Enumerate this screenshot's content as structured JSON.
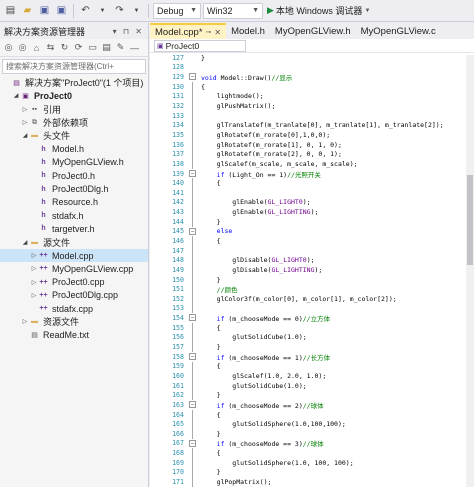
{
  "toolbar": {
    "config": "Debug",
    "platform": "Win32",
    "run_label": "本地 Windows 调试器"
  },
  "solution_explorer": {
    "title": "解决方案资源管理器",
    "search_placeholder": "搜索解决方案资源管理器(Ctrl+",
    "items": [
      {
        "label": "解决方案\"ProJect0\"(1 个项目)",
        "icon": "solution-icon",
        "indent": 0,
        "expander": ""
      },
      {
        "label": "ProJect0",
        "icon": "project-icon",
        "indent": 1,
        "expander": "▲",
        "bold": true
      },
      {
        "label": "引用",
        "icon": "references-icon",
        "indent": 2,
        "expander": "▶"
      },
      {
        "label": "外部依赖项",
        "icon": "external-deps-icon",
        "indent": 2,
        "expander": "▶"
      },
      {
        "label": "头文件",
        "icon": "folder-icon",
        "indent": 2,
        "expander": "▲"
      },
      {
        "label": "Model.h",
        "icon": "header-file-icon",
        "indent": 3,
        "expander": ""
      },
      {
        "label": "MyOpenGLView.h",
        "icon": "header-file-icon",
        "indent": 3,
        "expander": ""
      },
      {
        "label": "ProJect0.h",
        "icon": "header-file-icon",
        "indent": 3,
        "expander": ""
      },
      {
        "label": "ProJect0Dlg.h",
        "icon": "header-file-icon",
        "indent": 3,
        "expander": ""
      },
      {
        "label": "Resource.h",
        "icon": "header-file-icon",
        "indent": 3,
        "expander": ""
      },
      {
        "label": "stdafx.h",
        "icon": "header-file-icon",
        "indent": 3,
        "expander": ""
      },
      {
        "label": "targetver.h",
        "icon": "header-file-icon",
        "indent": 3,
        "expander": ""
      },
      {
        "label": "源文件",
        "icon": "folder-icon",
        "indent": 2,
        "expander": "▲"
      },
      {
        "label": "Model.cpp",
        "icon": "cpp-file-icon",
        "indent": 3,
        "expander": "▶",
        "selected": true
      },
      {
        "label": "MyOpenGLView.cpp",
        "icon": "cpp-file-icon",
        "indent": 3,
        "expander": "▶"
      },
      {
        "label": "ProJect0.cpp",
        "icon": "cpp-file-icon",
        "indent": 3,
        "expander": "▶"
      },
      {
        "label": "ProJect0Dlg.cpp",
        "icon": "cpp-file-icon",
        "indent": 3,
        "expander": "▶"
      },
      {
        "label": "stdafx.cpp",
        "icon": "cpp-file-icon",
        "indent": 3,
        "expander": ""
      },
      {
        "label": "资源文件",
        "icon": "folder-icon",
        "indent": 2,
        "expander": "▶"
      },
      {
        "label": "ReadMe.txt",
        "icon": "text-file-icon",
        "indent": 2,
        "expander": ""
      }
    ]
  },
  "editor": {
    "tabs": [
      {
        "label": "Model.cpp*",
        "active": true
      },
      {
        "label": "Model.h",
        "active": false
      },
      {
        "label": "MyOpenGLView.h",
        "active": false
      },
      {
        "label": "MyOpenGLView.c",
        "active": false
      }
    ],
    "nav_scope": "ProJect0",
    "lines": [
      {
        "n": "127",
        "code": "}"
      },
      {
        "n": "128",
        "code": ""
      },
      {
        "n": "129",
        "code": "void Model::Draw()//显示",
        "fold": true
      },
      {
        "n": "130",
        "code": "{"
      },
      {
        "n": "131",
        "code": "    lightmode();"
      },
      {
        "n": "132",
        "code": "    glPushMatrix();"
      },
      {
        "n": "133",
        "code": ""
      },
      {
        "n": "134",
        "code": "    glTranslatef(m_tranlate[0], m_tranlate[1], m_tranlate[2]);"
      },
      {
        "n": "135",
        "code": "    glRotatef(m_rorate[0],1,0,0);"
      },
      {
        "n": "136",
        "code": "    glRotatef(m_rorate[1], 0, 1, 0);"
      },
      {
        "n": "137",
        "code": "    glRotatef(m_rorate[2], 0, 0, 1);"
      },
      {
        "n": "138",
        "code": "    glScalef(m_scale, m_scale, m_scale);"
      },
      {
        "n": "139",
        "code": "    if (Light_On == 1)//光照开关",
        "fold": true
      },
      {
        "n": "140",
        "code": "    {"
      },
      {
        "n": "141",
        "code": ""
      },
      {
        "n": "142",
        "code": "        glEnable(GL_LIGHT0);"
      },
      {
        "n": "143",
        "code": "        glEnable(GL_LIGHTING);"
      },
      {
        "n": "144",
        "code": "    }"
      },
      {
        "n": "145",
        "code": "    else",
        "fold": true
      },
      {
        "n": "146",
        "code": "    {"
      },
      {
        "n": "147",
        "code": ""
      },
      {
        "n": "148",
        "code": "        glDisable(GL_LIGHT0);"
      },
      {
        "n": "149",
        "code": "        glDisable(GL_LIGHTING);"
      },
      {
        "n": "150",
        "code": "    }"
      },
      {
        "n": "151",
        "code": "    //颜色"
      },
      {
        "n": "152",
        "code": "    glColor3f(m_color[0], m_color[1], m_color[2]);"
      },
      {
        "n": "153",
        "code": ""
      },
      {
        "n": "154",
        "code": "    if (m_chooseMode == 0)//立方体",
        "fold": true
      },
      {
        "n": "155",
        "code": "    {"
      },
      {
        "n": "156",
        "code": "        glutSolidCube(1.0);"
      },
      {
        "n": "157",
        "code": "    }"
      },
      {
        "n": "158",
        "code": "    if (m_chooseMode == 1)//长方体",
        "fold": true
      },
      {
        "n": "159",
        "code": "    {"
      },
      {
        "n": "160",
        "code": "        glScalef(1.0, 2.0, 1.0);"
      },
      {
        "n": "161",
        "code": "        glutSolidCube(1.0);"
      },
      {
        "n": "162",
        "code": "    }"
      },
      {
        "n": "163",
        "code": "    if (m_chooseMode == 2)//球体",
        "fold": true
      },
      {
        "n": "164",
        "code": "    {"
      },
      {
        "n": "165",
        "code": "        glutSolidSphere(1.0,100,100);"
      },
      {
        "n": "166",
        "code": "    }"
      },
      {
        "n": "167",
        "code": "    if (m_chooseMode == 3)//球体",
        "fold": true
      },
      {
        "n": "168",
        "code": "    {"
      },
      {
        "n": "169",
        "code": "        glutSolidSphere(1.0, 100, 100);"
      },
      {
        "n": "170",
        "code": "    }"
      },
      {
        "n": "171",
        "code": "    glPopMatrix();"
      }
    ]
  }
}
